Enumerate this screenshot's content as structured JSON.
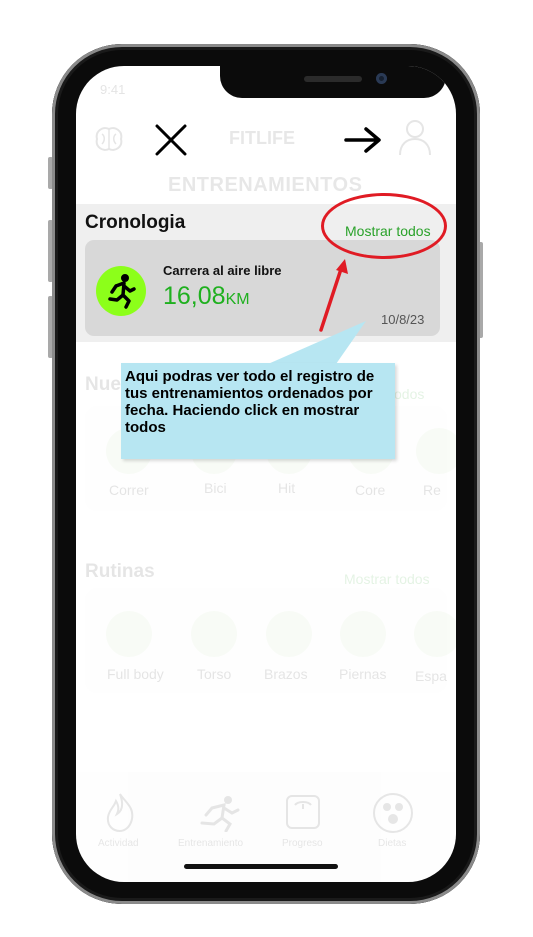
{
  "status": {
    "time": "9:41"
  },
  "header": {
    "app_title": "FITLIFE",
    "section_title": "ENTRENAMIENTOS"
  },
  "cronologia": {
    "title": "Cronologia",
    "link": "Mostrar todos",
    "entry": {
      "name": "Carrera al aire libre",
      "value": "16,08",
      "unit": "KM",
      "date": "10/8/23"
    },
    "accent_color": "#8cff1a"
  },
  "tooltip": {
    "text": "Aqui podras ver todo el registro de tus entrenamientos ordenados por fecha. Haciendo click en mostrar todos"
  },
  "nuevo": {
    "title": "Nue",
    "link": "odos",
    "items": [
      "Correr",
      "Bici",
      "Hit",
      "Core",
      "Re"
    ]
  },
  "rutinas": {
    "title": "Rutinas",
    "link": "Mostrar todos",
    "items": [
      "Full body",
      "Torso",
      "Brazos",
      "Piernas",
      "Espa"
    ]
  },
  "tabbar": {
    "items": [
      "Actividad",
      "Entrenamiento",
      "Progreso",
      "Dietas"
    ]
  },
  "colors": {
    "link_green": "#2aa22a",
    "highlight_red": "#e01b24",
    "tooltip_bg": "#b7e6f2"
  }
}
